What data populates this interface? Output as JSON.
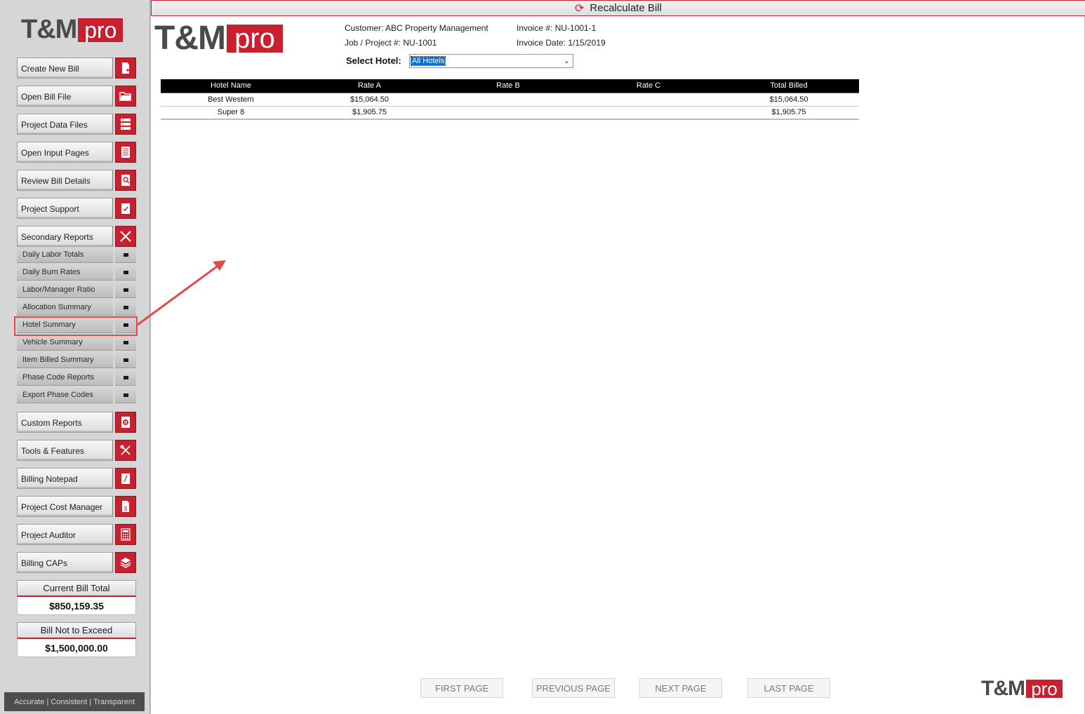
{
  "brand": {
    "tm": "T&M",
    "pro": "pro"
  },
  "sidebar": {
    "buttons": [
      {
        "label": "Create New Bill",
        "icon": "new-document-icon"
      },
      {
        "label": "Open Bill File",
        "icon": "folder-open-icon"
      },
      {
        "label": "Project Data Files",
        "icon": "database-icon"
      },
      {
        "label": "Open Input Pages",
        "icon": "list-icon"
      },
      {
        "label": "Review Bill Details",
        "icon": "magnify-document-icon"
      },
      {
        "label": "Project Support",
        "icon": "checklist-icon"
      },
      {
        "label": "Secondary Reports",
        "icon": "close-icon"
      }
    ],
    "sub_items": [
      {
        "label": "Daily Labor Totals"
      },
      {
        "label": "Daily Burn Rates"
      },
      {
        "label": "Labor/Manager Ratio"
      },
      {
        "label": "Allocation Summary"
      },
      {
        "label": "Hotel Summary"
      },
      {
        "label": "Vehicle Summary"
      },
      {
        "label": "Item Billed Summary"
      },
      {
        "label": "Phase Code Reports"
      },
      {
        "label": "Export Phase Codes"
      }
    ],
    "buttons2": [
      {
        "label": "Custom Reports",
        "icon": "gear-document-icon"
      },
      {
        "label": "Tools & Features",
        "icon": "tools-icon"
      },
      {
        "label": "Billing Notepad",
        "icon": "notepad-icon"
      },
      {
        "label": "Project Cost Manager",
        "icon": "dollar-document-icon"
      },
      {
        "label": "Project Auditor",
        "icon": "calculator-icon"
      },
      {
        "label": "Billing CAPs",
        "icon": "layers-icon"
      }
    ],
    "current_bill_total": {
      "label": "Current Bill Total",
      "value": "$850,159.35"
    },
    "bill_not_to_exceed": {
      "label": "Bill Not to Exceed",
      "value": "$1,500,000.00"
    },
    "tagline": "Accurate  |  Consistent  |  Transparent"
  },
  "main": {
    "recalc_label": "Recalculate Bill",
    "customer": "Customer: ABC Property Management",
    "job": "Job / Project #: NU-1001",
    "invoice_no": "Invoice #: NU-1001-1",
    "invoice_date": "Invoice Date: 1/15/2019",
    "select_hotel_label": "Select Hotel:",
    "select_hotel_value": "All Hotels",
    "table": {
      "headers": [
        "Hotel Name",
        "Rate A",
        "Rate B",
        "Rate C",
        "Total Billed"
      ],
      "rows": [
        [
          "Best Western",
          "$15,064.50",
          "",
          "",
          "$15,064.50"
        ],
        [
          "Super 8",
          "$1,905.75",
          "",
          "",
          "$1,905.75"
        ]
      ]
    },
    "pagination": {
      "first": "FIRST PAGE",
      "previous": "PREVIOUS PAGE",
      "next": "NEXT PAGE",
      "last": "LAST PAGE"
    }
  },
  "colors": {
    "accent": "#c8202e",
    "annotation": "#e24a4a"
  }
}
